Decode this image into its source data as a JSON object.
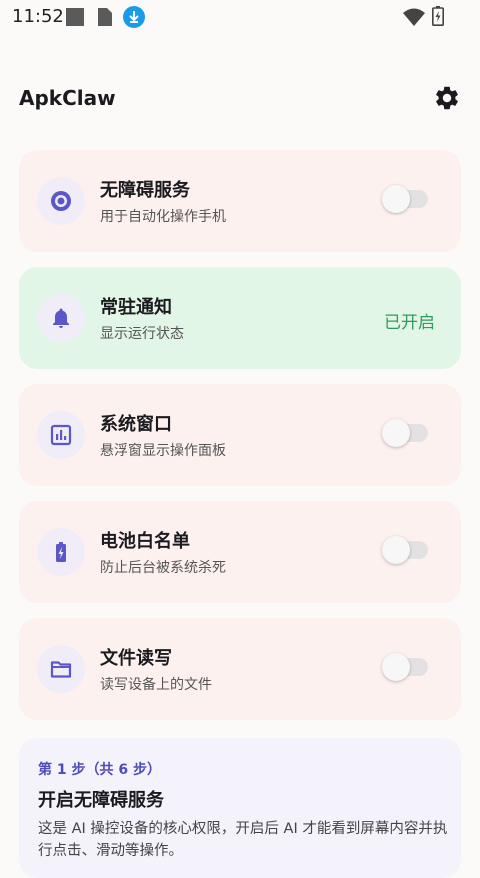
{
  "status_bar": {
    "time": "11:52",
    "icons": [
      "notification-square-icon",
      "sim-card-icon",
      "download-icon",
      "wifi-icon",
      "battery-charging-icon"
    ]
  },
  "app": {
    "title": "ApkClaw",
    "settings_icon": "gear-icon"
  },
  "permissions": [
    {
      "title": "无障碍服务",
      "subtitle": "用于自动化操作手机",
      "icon": "target-icon",
      "enabled": false
    },
    {
      "title": "常驻通知",
      "subtitle": "显示运行状态",
      "icon": "bell-icon",
      "enabled": true,
      "status_label": "已开启"
    },
    {
      "title": "系统窗口",
      "subtitle": "悬浮窗显示操作面板",
      "icon": "chart-icon",
      "enabled": false
    },
    {
      "title": "电池白名单",
      "subtitle": "防止后台被系统杀死",
      "icon": "battery-bolt-icon",
      "enabled": false
    },
    {
      "title": "文件读写",
      "subtitle": "读写设备上的文件",
      "icon": "folder-icon",
      "enabled": false
    }
  ],
  "guide": {
    "step": "第 1 步（共 6 步）",
    "title": "开启无障碍服务",
    "description": "这是 AI 操控设备的核心权限，开启后 AI 才能看到屏幕内容并执行点击、滑动等操作。"
  },
  "colors": {
    "accent": "#5b57c9",
    "on_green": "#2e9c5e",
    "card_off": "#fdf1ef",
    "card_on": "#e2f6e7"
  }
}
